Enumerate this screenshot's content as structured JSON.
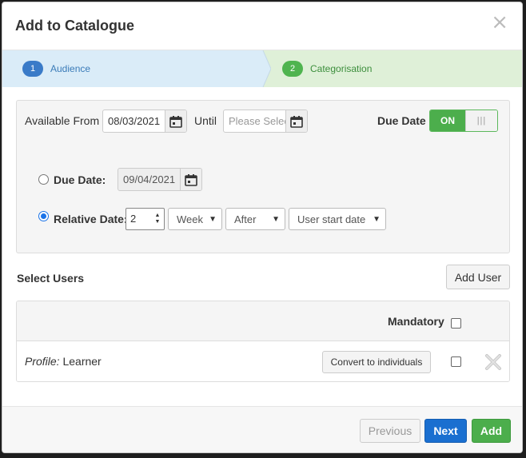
{
  "modal": {
    "title": "Add to Catalogue",
    "close_glyph": "×"
  },
  "wizard": {
    "steps": [
      {
        "number": "1",
        "label": "Audience",
        "active": true
      },
      {
        "number": "2",
        "label": "Categorisation",
        "active": false
      }
    ]
  },
  "availability": {
    "from_label": "Available From",
    "from_value": "08/03/2021",
    "until_label": "Until",
    "until_placeholder": "Please Select",
    "due_date_label": "Due Date",
    "toggle_on_label": "ON",
    "toggle_handle_glyph": "|||"
  },
  "due_options": {
    "due_date_label": "Due Date:",
    "due_date_value": "09/04/2021",
    "relative_date_label": "Relative Date:",
    "relative_value": "2",
    "unit_selected": "Week",
    "direction_selected": "After",
    "anchor_selected": "User start date",
    "selected_option": "relative"
  },
  "users": {
    "section_title": "Select Users",
    "add_user_label": "Add User",
    "mandatory_header": "Mandatory",
    "rows": [
      {
        "profile_prefix": "Profile:",
        "profile_name": "Learner",
        "convert_label": "Convert to individuals"
      }
    ]
  },
  "footer": {
    "previous_label": "Previous",
    "next_label": "Next",
    "add_label": "Add"
  },
  "colors": {
    "step_active_bg": "#daecf8",
    "step_inactive_bg": "#dff0d8",
    "primary": "#1a6fd0",
    "success": "#4cae4c"
  },
  "icons": [
    "calendar-icon",
    "close-icon",
    "remove-icon",
    "caret-down-icon",
    "spin-up-icon",
    "spin-down-icon"
  ]
}
